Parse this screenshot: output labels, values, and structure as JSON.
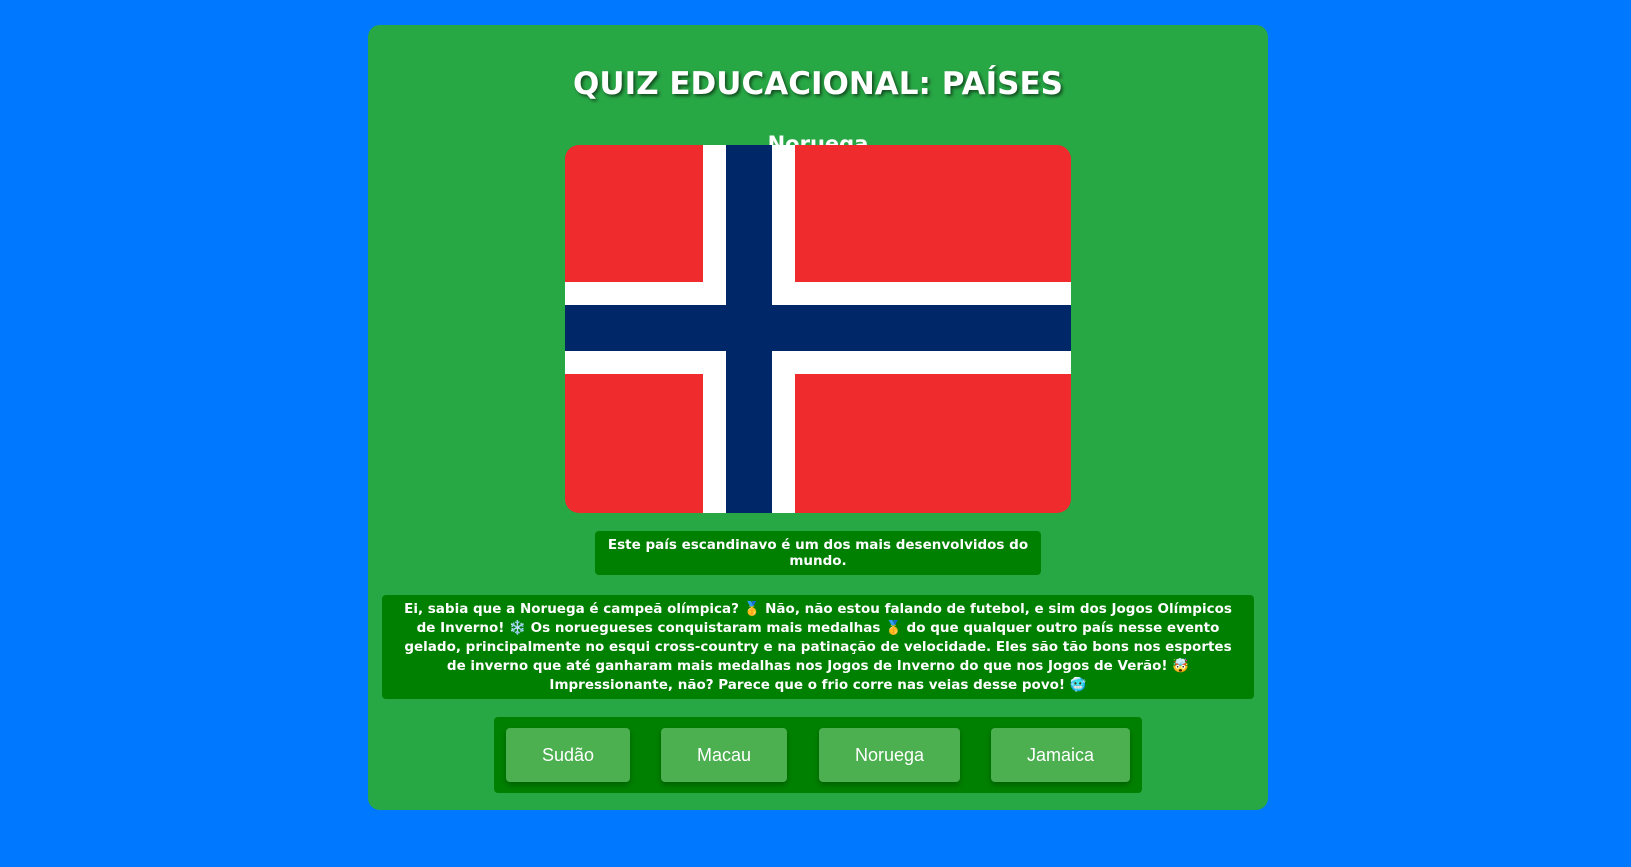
{
  "quiz": {
    "title": "QUIZ EDUCACIONAL: PAÍSES",
    "country_name": "Noruega",
    "flag": {
      "country": "Noruega",
      "colors": {
        "field": "#ef2b2d",
        "border_cross": "#ffffff",
        "inner_cross": "#002868"
      }
    },
    "hint": "Este país escandinavo é um dos mais desenvolvidos do mundo.",
    "fact": "Ei, sabia que a Noruega é campeã olímpica? 🥇 Não, não estou falando de futebol, e sim dos Jogos Olímpicos de Inverno! ❄️ Os noruegueses conquistaram mais medalhas 🥇 do que qualquer outro país nesse evento gelado, principalmente no esqui cross-country e na patinação de velocidade. Eles são tão bons nos esportes de inverno que até ganharam mais medalhas nos Jogos de Inverno do que nos Jogos de Verão! 🤯 Impressionante, não? Parece que o frio corre nas veias desse povo! 🥶",
    "options": [
      "Sudão",
      "Macau",
      "Noruega",
      "Jamaica"
    ]
  },
  "colors": {
    "page_background": "#0078ff",
    "card_background": "#28a745",
    "panel_background": "#008000",
    "button_background": "#4caf50",
    "text": "#ffffff"
  }
}
